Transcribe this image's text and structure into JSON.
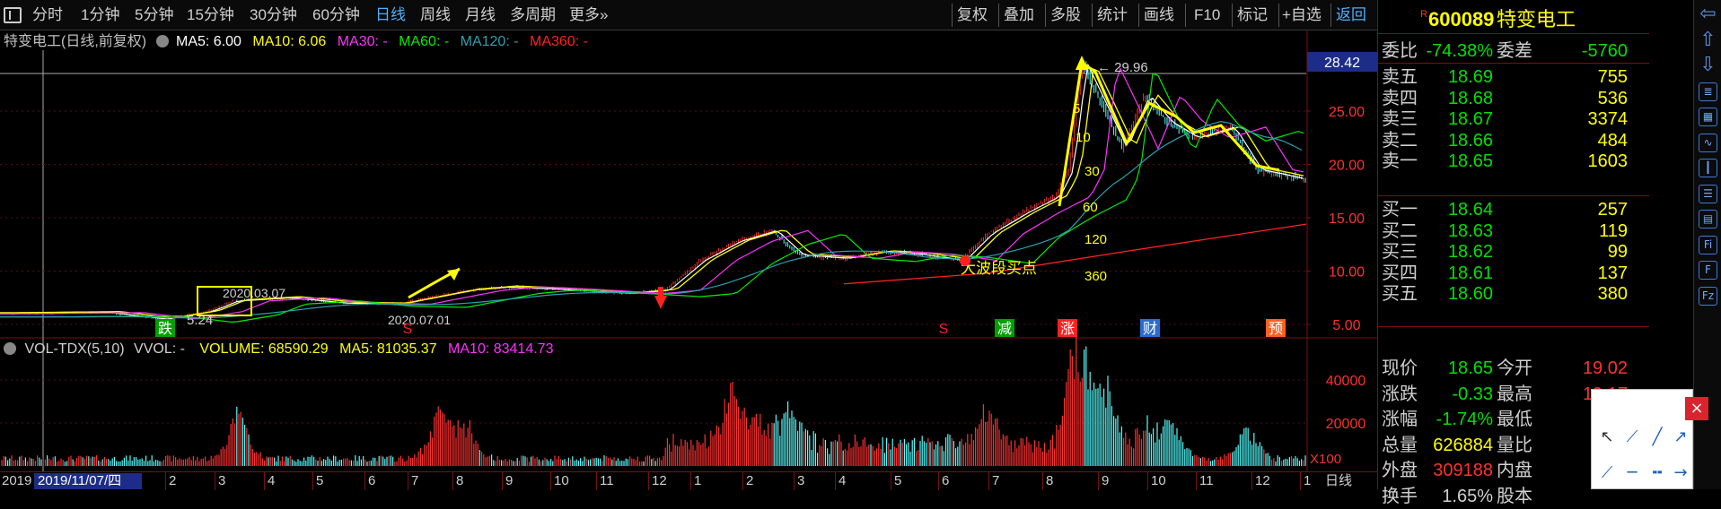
{
  "toolbar": {
    "left_items": [
      "分时",
      "1分钟",
      "5分钟",
      "15分钟",
      "30分钟",
      "60分钟",
      "日线",
      "周线",
      "月线",
      "多周期",
      "更多»"
    ],
    "active_index": 6,
    "right_items": [
      "复权",
      "叠加",
      "多股",
      "统计",
      "画线",
      "F10",
      "标记",
      "+自选",
      "返回"
    ]
  },
  "chart": {
    "title": "特变电工(日线,前复权)",
    "ma_labels": [
      {
        "text": "MA5: 6.00",
        "color": "#ffffff"
      },
      {
        "text": "MA10: 6.06",
        "color": "#ffff00"
      },
      {
        "text": "MA30: -",
        "color": "#ff30ff"
      },
      {
        "text": "MA60: -",
        "color": "#00ee00"
      },
      {
        "text": "MA120: -",
        "color": "#2aa0b0"
      },
      {
        "text": "MA360: -",
        "color": "#ff2020"
      }
    ],
    "cursor_price": "28.42",
    "y_ticks": [
      "25.00",
      "20.00",
      "15.00",
      "10.00",
      "5.00"
    ],
    "annotations": {
      "high": "29.96",
      "low": "5.24",
      "date1": "2020.03.07",
      "date2": "2020.07.01",
      "buy_point": "大波段买点",
      "ma_tags": [
        "5",
        "10",
        "30",
        "60",
        "120",
        "360"
      ]
    },
    "markers": [
      "跌",
      "S",
      "S",
      "减",
      "涨",
      "财",
      "预"
    ]
  },
  "volume": {
    "title": "VOL-TDX(5,10)",
    "vvol": "VVOL: -",
    "volume": "VOLUME: 68590.29",
    "ma5": "MA5: 81035.37",
    "ma10": "MA10: 83414.73",
    "y_ticks": [
      "40000",
      "20000"
    ],
    "unit": "X100"
  },
  "date_axis": {
    "year": "2019",
    "cursor_date": "2019/11/07/四",
    "months": [
      "2",
      "3",
      "4",
      "5",
      "6",
      "7",
      "8",
      "9",
      "10",
      "11",
      "12",
      "1",
      "2",
      "3",
      "4",
      "5",
      "6",
      "7",
      "8",
      "9",
      "10",
      "11",
      "12",
      "1"
    ],
    "period": "日线"
  },
  "quote": {
    "code": "600089",
    "name": "特变电工",
    "r_mark": "R",
    "weibi": {
      "label": "委比",
      "value": "-74.38%",
      "label2": "委差",
      "value2": "-5760"
    },
    "asks": [
      {
        "label": "卖五",
        "price": "18.69",
        "vol": "755"
      },
      {
        "label": "卖四",
        "price": "18.68",
        "vol": "536"
      },
      {
        "label": "卖三",
        "price": "18.67",
        "vol": "3374"
      },
      {
        "label": "卖二",
        "price": "18.66",
        "vol": "484"
      },
      {
        "label": "卖一",
        "price": "18.65",
        "vol": "1603"
      }
    ],
    "bids": [
      {
        "label": "买一",
        "price": "18.64",
        "vol": "257"
      },
      {
        "label": "买二",
        "price": "18.63",
        "vol": "119"
      },
      {
        "label": "买三",
        "price": "18.62",
        "vol": "99"
      },
      {
        "label": "买四",
        "price": "18.61",
        "vol": "137"
      },
      {
        "label": "买五",
        "price": "18.60",
        "vol": "380"
      }
    ],
    "stats": [
      {
        "label": "现价",
        "value": "18.65",
        "label2": "今开",
        "value2": "19.02"
      },
      {
        "label": "涨跌",
        "value": "-0.33",
        "label2": "最高",
        "value2": "19.17"
      },
      {
        "label": "涨幅",
        "value": "-1.74%",
        "label2": "最低",
        "value2": ""
      },
      {
        "label": "总量",
        "value": "626884",
        "label2": "量比",
        "value2": ""
      },
      {
        "label": "外盘",
        "value": "309188",
        "label2": "内盘",
        "value2": ""
      },
      {
        "label": "换手",
        "value": "1.65%",
        "label2": "股本",
        "value2": ""
      }
    ]
  },
  "sidebar_icons": [
    "arrow-left-icon",
    "arrow-up-icon",
    "arrow-down-icon",
    "quote-icon",
    "table-icon",
    "line-chart-icon",
    "candle-icon",
    "list-icon",
    "fund-icon",
    "fib-icon",
    "f10-icon",
    "fiz-icon"
  ],
  "draw_tools": [
    "cursor-tool-icon",
    "segment-tool-icon",
    "line-tool-icon",
    "ray-tool-icon",
    "trend-tool-icon",
    "hline-tool-icon",
    "dot-line-tool-icon",
    "arrow-line-tool-icon"
  ],
  "chart_data": {
    "type": "line",
    "x": [
      "2019-11",
      "2019-12",
      "2020-01",
      "2020-02",
      "2020-03",
      "2020-04",
      "2020-05",
      "2020-06",
      "2020-07",
      "2020-08",
      "2020-09",
      "2020-10",
      "2020-11",
      "2020-12",
      "2021-01",
      "2021-02",
      "2021-03",
      "2021-04",
      "2021-05",
      "2021-06",
      "2021-07",
      "2021-08",
      "2021-09",
      "2021-10",
      "2021-11",
      "2021-12",
      "2022-01",
      "2022-02"
    ],
    "series": [
      {
        "name": "MA5",
        "values": [
          6.0,
          6.1,
          6.3,
          6.0,
          6.6,
          7.3,
          7.4,
          7.0,
          6.9,
          8.3,
          8.6,
          8.5,
          8.1,
          8.3,
          13.0,
          13.4,
          11.3,
          11.0,
          11.8,
          11.6,
          11.4,
          14.6,
          16.7,
          28.2,
          23.0,
          24.2,
          23.5,
          18.7
        ]
      },
      {
        "name": "MA10",
        "values": [
          6.06,
          6.1,
          6.3,
          6.1,
          6.5,
          7.2,
          7.3,
          7.1,
          7.0,
          8.1,
          8.5,
          8.5,
          8.2,
          8.3,
          12.6,
          13.2,
          11.6,
          11.1,
          11.7,
          11.6,
          11.4,
          14.2,
          16.3,
          26.8,
          23.5,
          24.0,
          23.6,
          19.2
        ]
      }
    ],
    "ylim": [
      5,
      30
    ],
    "volume_ylim": [
      0,
      50000
    ]
  }
}
